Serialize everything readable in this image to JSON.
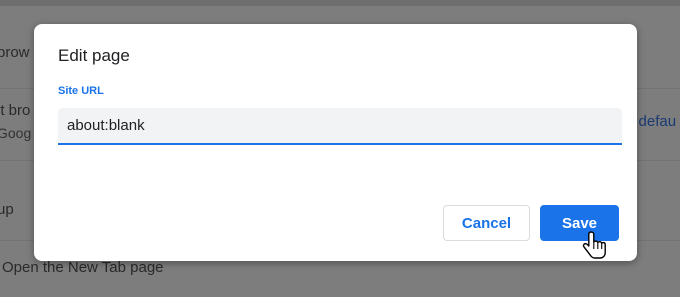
{
  "background": {
    "line1": "brow",
    "line2": "lt bro",
    "line2_sub": "Goog",
    "line2_link": "e defau",
    "line3": "up",
    "line4": "Open the New Tab page"
  },
  "dialog": {
    "title": "Edit page",
    "field_label": "Site URL",
    "url_value": "about:blank",
    "cancel_label": "Cancel",
    "save_label": "Save"
  },
  "colors": {
    "accent": "#1a73e8",
    "overlay": "#7d7d7d",
    "input_bg": "#f1f3f4"
  },
  "icons": {
    "cursor": "hand-pointer-icon"
  }
}
